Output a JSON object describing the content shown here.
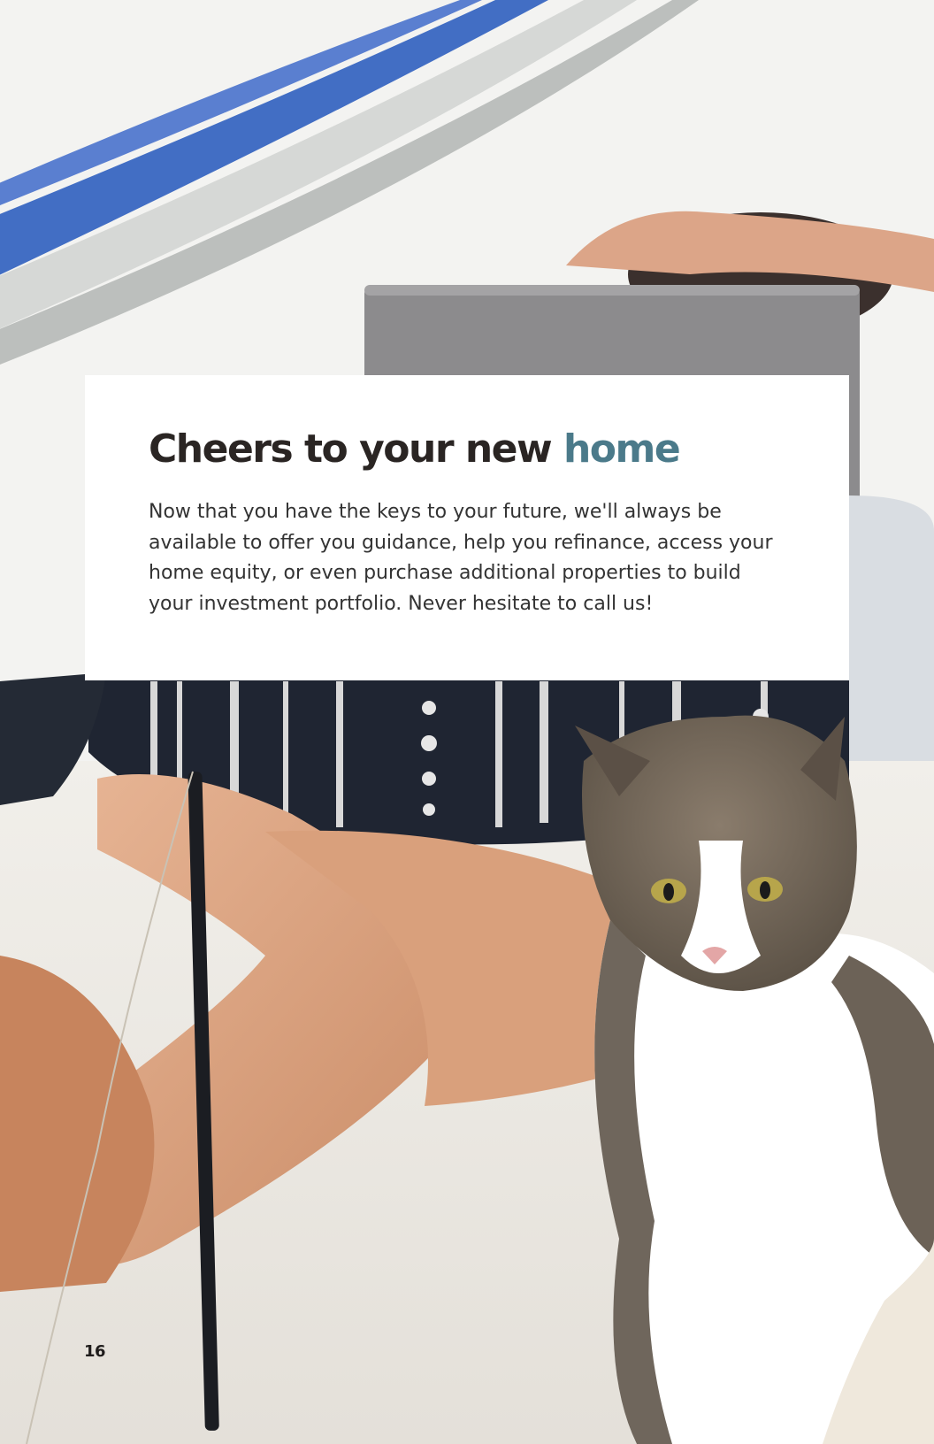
{
  "heading": {
    "main": "Cheers to your new ",
    "accent": "home"
  },
  "body": "Now that you have the keys to your future, we'll always be available to offer you guidance, help you refinance, access your home equity, or even purchase additional properties to build your investment portfolio. Never hesitate to call us!",
  "page_number": "16",
  "colors": {
    "heading": "#2a2523",
    "accent": "#4b7a8a",
    "body_text": "#333333",
    "card": "#ffffff"
  }
}
